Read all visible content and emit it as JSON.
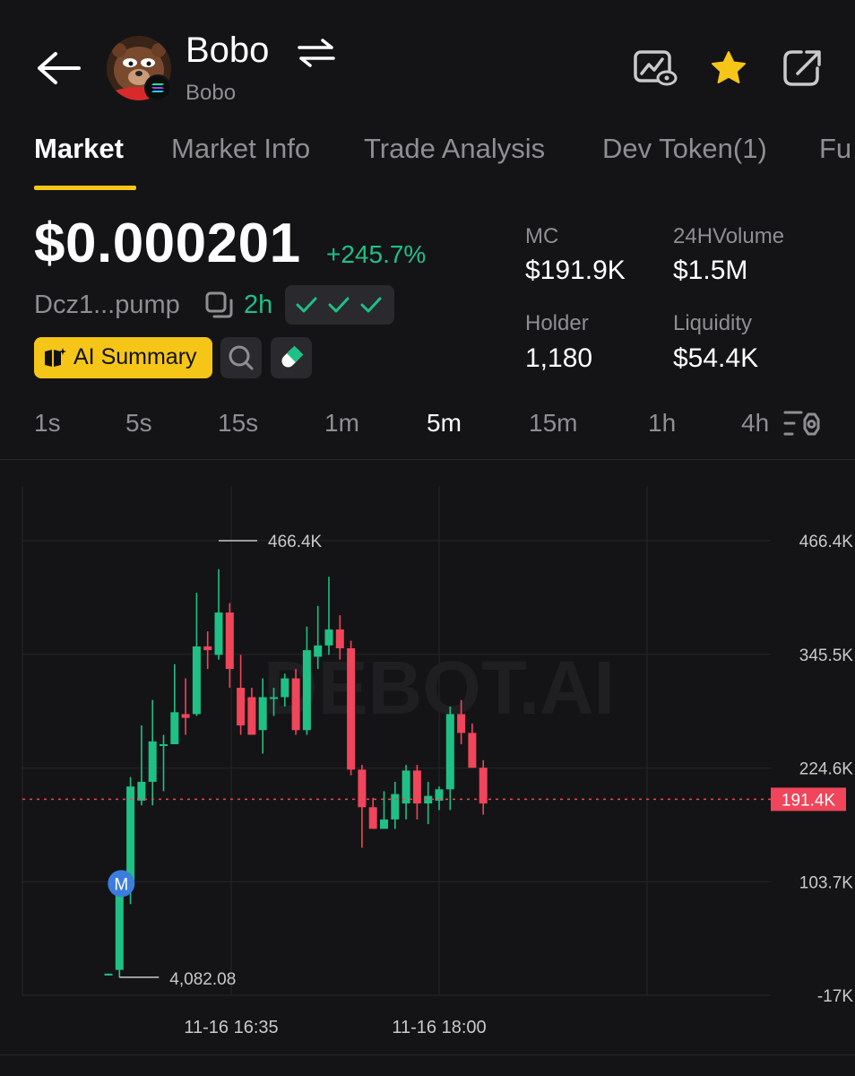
{
  "header": {
    "token_name": "Bobo",
    "token_subtitle": "Bobo",
    "back_icon": "arrow-left-icon",
    "swap_icon": "swap-arrows-icon",
    "watch_icon": "chart-eye-icon",
    "favorite_icon": "star-icon",
    "share_icon": "share-icon",
    "favorite_color": "#f5c518"
  },
  "tabs": [
    {
      "label": "Market",
      "active": true
    },
    {
      "label": "Market Info",
      "active": false
    },
    {
      "label": "Trade Analysis",
      "active": false
    },
    {
      "label": "Dev Token(1)",
      "active": false
    },
    {
      "label": "Fu",
      "active": false
    }
  ],
  "price": {
    "value": "$0.000201",
    "change": "+245.7%",
    "address": "Dcz1...pump",
    "age": "2h",
    "up_color": "#1fc086",
    "down_color": "#f0455a"
  },
  "actions": {
    "ai_summary_label": "AI Summary"
  },
  "stats": {
    "mc_label": "MC",
    "mc_value": "$191.9K",
    "volume_label": "24HVolume",
    "volume_value": "$1.5M",
    "holder_label": "Holder",
    "holder_value": "1,180",
    "liquidity_label": "Liquidity",
    "liquidity_value": "$54.4K"
  },
  "intervals": [
    {
      "label": "1s",
      "active": false
    },
    {
      "label": "5s",
      "active": false
    },
    {
      "label": "15s",
      "active": false
    },
    {
      "label": "1m",
      "active": false
    },
    {
      "label": "5m",
      "active": true
    },
    {
      "label": "15m",
      "active": false
    },
    {
      "label": "1h",
      "active": false
    },
    {
      "label": "4h",
      "active": false
    }
  ],
  "chart_data": {
    "type": "candlestick",
    "watermark": "DEBOT.AI",
    "y_ticks": [
      "466.4K",
      "345.5K",
      "224.6K",
      "103.7K",
      "-17K"
    ],
    "y_tick_values": [
      466.4,
      345.5,
      224.6,
      103.7,
      -17
    ],
    "ylim": [
      -17,
      466.4
    ],
    "x_ticks": [
      "11-16 16:35",
      "11-16 18:00"
    ],
    "current_price_label": "191.4K",
    "current_price_value": 191.4,
    "high_label": "466.4K",
    "low_label": "4,082.08",
    "marker_label": "M",
    "candles": [
      {
        "o": 4.1,
        "c": 6,
        "h": 6,
        "l": 4.1
      },
      {
        "o": 10,
        "c": 100,
        "h": 104,
        "l": 2
      },
      {
        "o": 105,
        "c": 205,
        "h": 215,
        "l": 80
      },
      {
        "o": 190,
        "c": 210,
        "h": 270,
        "l": 185
      },
      {
        "o": 210,
        "c": 253,
        "h": 297,
        "l": 185
      },
      {
        "o": 250,
        "c": 250,
        "h": 260,
        "l": 200
      },
      {
        "o": 250,
        "c": 284,
        "h": 335,
        "l": 250
      },
      {
        "o": 282,
        "c": 278,
        "h": 320,
        "l": 260
      },
      {
        "o": 282,
        "c": 354,
        "h": 411,
        "l": 280
      },
      {
        "o": 354,
        "c": 350,
        "h": 370,
        "l": 330
      },
      {
        "o": 345,
        "c": 390,
        "h": 436,
        "l": 340
      },
      {
        "o": 390,
        "c": 330,
        "h": 400,
        "l": 310
      },
      {
        "o": 310,
        "c": 270,
        "h": 345,
        "l": 260
      },
      {
        "o": 300,
        "c": 260,
        "h": 310,
        "l": 260
      },
      {
        "o": 265,
        "c": 300,
        "h": 320,
        "l": 240
      },
      {
        "o": 300,
        "c": 300,
        "h": 310,
        "l": 280
      },
      {
        "o": 300,
        "c": 320,
        "h": 325,
        "l": 290
      },
      {
        "o": 320,
        "c": 265,
        "h": 330,
        "l": 260
      },
      {
        "o": 265,
        "c": 350,
        "h": 375,
        "l": 260
      },
      {
        "o": 343,
        "c": 355,
        "h": 397,
        "l": 330
      },
      {
        "o": 355,
        "c": 372,
        "h": 428,
        "l": 345
      },
      {
        "o": 372,
        "c": 352,
        "h": 387,
        "l": 340
      },
      {
        "o": 352,
        "c": 223,
        "h": 360,
        "l": 217
      },
      {
        "o": 223,
        "c": 183,
        "h": 228,
        "l": 140
      },
      {
        "o": 183,
        "c": 160,
        "h": 193,
        "l": 160
      },
      {
        "o": 160,
        "c": 170,
        "h": 200,
        "l": 170
      },
      {
        "o": 170,
        "c": 197,
        "h": 210,
        "l": 160
      },
      {
        "o": 187,
        "c": 222,
        "h": 228,
        "l": 170
      },
      {
        "o": 222,
        "c": 187,
        "h": 228,
        "l": 170
      },
      {
        "o": 187,
        "c": 195,
        "h": 210,
        "l": 165
      },
      {
        "o": 190,
        "c": 202,
        "h": 205,
        "l": 180
      },
      {
        "o": 202,
        "c": 282,
        "h": 290,
        "l": 180
      },
      {
        "o": 282,
        "c": 262,
        "h": 297,
        "l": 250
      },
      {
        "o": 262,
        "c": 225,
        "h": 272,
        "l": 225
      },
      {
        "o": 225,
        "c": 187,
        "h": 233,
        "l": 175
      }
    ]
  }
}
